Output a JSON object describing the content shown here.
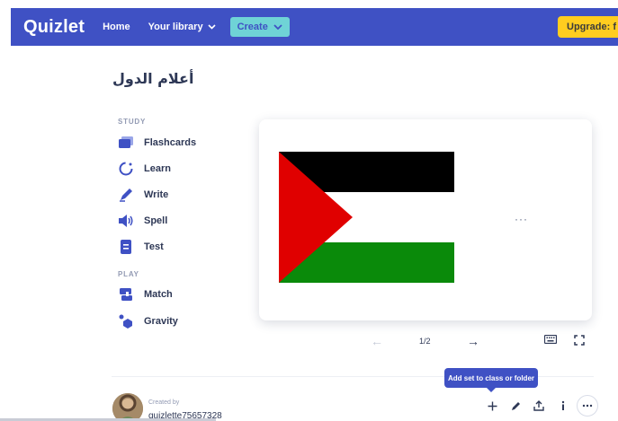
{
  "nav": {
    "logo": "Quizlet",
    "home": "Home",
    "library": "Your library",
    "create": "Create",
    "upgrade": "Upgrade: f"
  },
  "set": {
    "title": "أعلام الدول"
  },
  "study": {
    "section_label": "STUDY",
    "modes": [
      {
        "label": "Flashcards",
        "icon": "flashcards-icon"
      },
      {
        "label": "Learn",
        "icon": "learn-icon"
      },
      {
        "label": "Write",
        "icon": "write-icon"
      },
      {
        "label": "Spell",
        "icon": "spell-icon"
      },
      {
        "label": "Test",
        "icon": "test-icon"
      }
    ]
  },
  "play": {
    "section_label": "PLAY",
    "modes": [
      {
        "label": "Match",
        "icon": "match-icon"
      },
      {
        "label": "Gravity",
        "icon": "gravity-icon"
      }
    ]
  },
  "card": {
    "more_glyph": "···",
    "flag_colors": {
      "black": "#000000",
      "white": "#ffffff",
      "green": "#0a8a0a",
      "red": "#e00000"
    }
  },
  "controls": {
    "prev_glyph": "←",
    "counter": "1/2",
    "next_glyph": "→"
  },
  "footer": {
    "created_by": "Created by",
    "author": "quizlette75657328",
    "tooltip": "Add set to class or folder"
  },
  "colors": {
    "brand": "#3f51c4",
    "create": "#6fd3d6",
    "upgrade": "#ffcd1f",
    "icon": "#3f51c4"
  }
}
